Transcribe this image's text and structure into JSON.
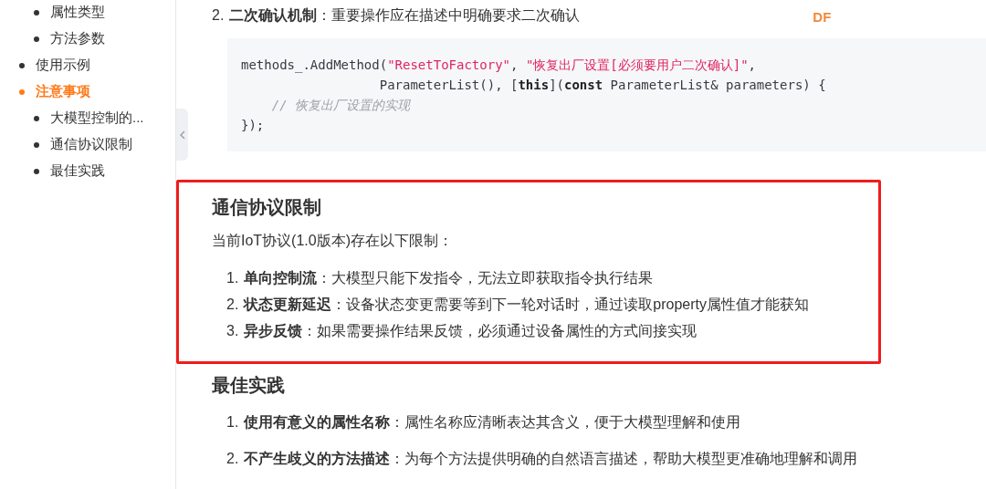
{
  "sidebar": {
    "sub_items_top": [
      {
        "label": "属性类型"
      },
      {
        "label": "方法参数"
      }
    ],
    "items": [
      {
        "label": "使用示例",
        "selected": false
      },
      {
        "label": "注意事项",
        "selected": true,
        "children": [
          {
            "label": "大模型控制的..."
          },
          {
            "label": "通信协议限制"
          },
          {
            "label": "最佳实践"
          }
        ]
      }
    ]
  },
  "brand_mark": "DF",
  "intro_item": {
    "number": "2.",
    "text": "**二次确认机制**：重要操作应在描述中明确要求二次确认"
  },
  "code_block": {
    "lines": [
      [
        {
          "kind": "plain",
          "text": "methods_.AddMethod("
        },
        {
          "kind": "string",
          "text": "\"ResetToFactory\""
        },
        {
          "kind": "plain",
          "text": ", "
        },
        {
          "kind": "string",
          "text": "\"恢复出厂设置[必须要用户二次确认]\""
        },
        {
          "kind": "plain",
          "text": ","
        }
      ],
      [
        {
          "kind": "plain",
          "text": "                  ParameterList(), ["
        },
        {
          "kind": "keyword",
          "text": "this"
        },
        {
          "kind": "plain",
          "text": "]("
        },
        {
          "kind": "keyword",
          "text": "const"
        },
        {
          "kind": "plain",
          "text": " ParameterList& parameters) {"
        }
      ],
      [
        {
          "kind": "comment",
          "text": "    // 恢复出厂设置的实现"
        }
      ],
      [
        {
          "kind": "plain",
          "text": "});"
        }
      ]
    ]
  },
  "sections": [
    {
      "title": "通信协议限制",
      "highlighted": true,
      "intro": "当前IoT协议(1.0版本)存在以下限制：",
      "items": [
        {
          "number": "1.",
          "text": "**单向控制流**：大模型只能下发指令，无法立即获取指令执行结果"
        },
        {
          "number": "2.",
          "text": "**状态更新延迟**：设备状态变更需要等到下一轮对话时，通过读取property属性值才能获知"
        },
        {
          "number": "3.",
          "text": "**异步反馈**：如果需要操作结果反馈，必须通过设备属性的方式间接实现"
        }
      ]
    },
    {
      "title": "最佳实践",
      "highlighted": false,
      "items": [
        {
          "number": "1.",
          "text": "**使用有意义的属性名称**：属性名称应清晰表达其含义，便于大模型理解和使用"
        },
        {
          "number": "2.",
          "text": "**不产生歧义的方法描述**：为每个方法提供明确的自然语言描述，帮助大模型更准确地理解和调用"
        }
      ]
    }
  ]
}
